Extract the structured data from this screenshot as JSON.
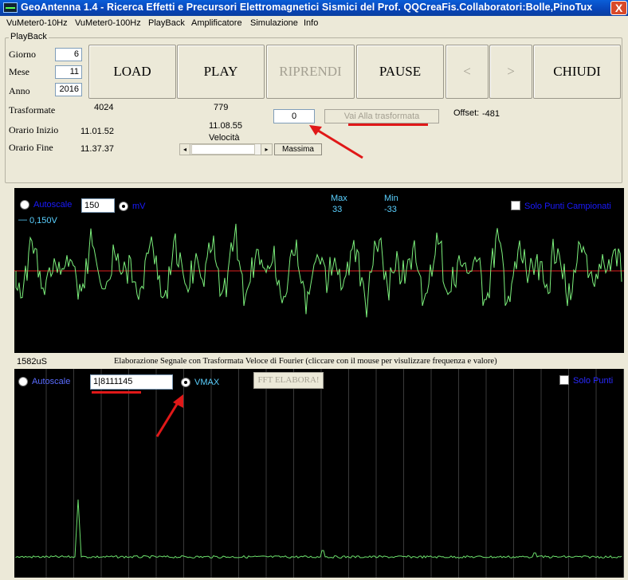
{
  "window": {
    "title": "GeoAntenna 1.4 - Ricerca Effetti e Precursori Elettromagnetici Sismici del Prof. QQCreaFis.Collaboratori:Bolle,PinoTux",
    "close_glyph": "X"
  },
  "menu": [
    "VuMeter0-10Hz",
    "VuMeter0-100Hz",
    "PlayBack",
    "Amplificatore",
    "Simulazione",
    "Info"
  ],
  "playback": {
    "group_label": "PlayBack",
    "giorno_label": "Giorno",
    "giorno_value": "6",
    "mese_label": "Mese",
    "mese_value": "11",
    "anno_label": "Anno",
    "anno_value": "2016",
    "buttons": {
      "load": "LOAD",
      "play": "PLAY",
      "riprendi": "RIPRENDI",
      "pause": "PAUSE",
      "prev": "<",
      "next": ">",
      "chiudi": "CHIUDI"
    },
    "trasformate_label": "Trasformate",
    "trasformate_total": "4024",
    "trasformate_current": "779",
    "goto_value": "0",
    "goto_button": "Vai Alla trasformata",
    "offset_label": "Offset:",
    "offset_value": "-481",
    "orario_inizio_label": "Orario Inizio",
    "orario_inizio_value": "11.01.52",
    "orario_fine_label": "Orario Fine",
    "orario_fine_value": "11.37.37",
    "current_time": "11.08.55",
    "velocita_label": "Velocità",
    "massima_button": "Massima"
  },
  "scope_time": {
    "autoscale_label": "Autoscale",
    "scale_value": "150",
    "unit_label": "mV",
    "scale_readout": "0,150V",
    "max_label": "Max",
    "max_value": "33",
    "min_label": "Min",
    "min_value": "-33",
    "solo_punti_label": "Solo Punti Campionati",
    "sample_period": "1582uS",
    "colors": {
      "trace": "#7cf07c",
      "baseline": "#e02020",
      "background": "#000000"
    }
  },
  "fft": {
    "caption": "Elaborazione Segnale con Trasformata Veloce di Fourier (cliccare con il mouse per visulizzare frequenza e valore)",
    "autoscale_label": "Autoscale",
    "vmax_value": "1|8111145",
    "vmax_label": "VMAX",
    "elabora_button": "FFT ELABORA!",
    "solo_punti_label": "Solo Punti",
    "colors": {
      "trace": "#6ce06c",
      "grid": "#3a3a3a"
    }
  },
  "annotation_colors": {
    "arrow": "#e01818"
  }
}
